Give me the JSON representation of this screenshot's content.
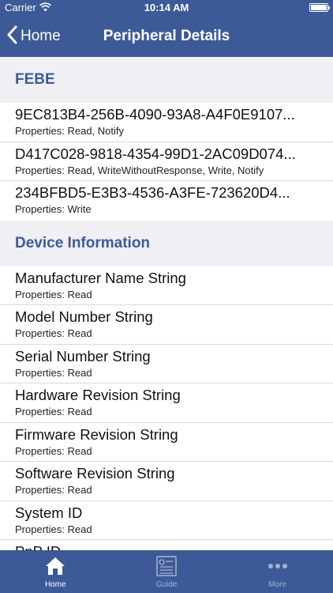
{
  "status_bar": {
    "carrier": "Carrier",
    "time": "10:14 AM"
  },
  "nav": {
    "back_label": "Home",
    "title": "Peripheral Details"
  },
  "sections": [
    {
      "title": "FEBE",
      "rows": [
        {
          "name": "9EC813B4-256B-4090-93A8-A4F0E9107...",
          "properties": "Properties: Read, Notify"
        },
        {
          "name": "D417C028-9818-4354-99D1-2AC09D074...",
          "properties": "Properties: Read, WriteWithoutResponse, Write, Notify"
        },
        {
          "name": "234BFBD5-E3B3-4536-A3FE-723620D4...",
          "properties": "Properties: Write"
        }
      ]
    },
    {
      "title": "Device Information",
      "rows": [
        {
          "name": "Manufacturer Name String",
          "properties": "Properties: Read"
        },
        {
          "name": "Model Number String",
          "properties": "Properties: Read"
        },
        {
          "name": "Serial Number String",
          "properties": "Properties: Read"
        },
        {
          "name": "Hardware Revision String",
          "properties": "Properties: Read"
        },
        {
          "name": "Firmware Revision String",
          "properties": "Properties: Read"
        },
        {
          "name": "Software Revision String",
          "properties": "Properties: Read"
        },
        {
          "name": "System ID",
          "properties": "Properties: Read"
        },
        {
          "name": "PnP ID",
          "properties": ""
        }
      ]
    }
  ],
  "tab_bar": {
    "tabs": [
      {
        "label": "Home",
        "icon": "home-icon",
        "active": true
      },
      {
        "label": "Guide",
        "icon": "guide-icon",
        "active": false
      },
      {
        "label": "More",
        "icon": "more-icon",
        "active": false
      }
    ]
  },
  "colors": {
    "brand": "#3d5a98",
    "section_bg": "#efeff4",
    "separator": "#d9d9de"
  }
}
